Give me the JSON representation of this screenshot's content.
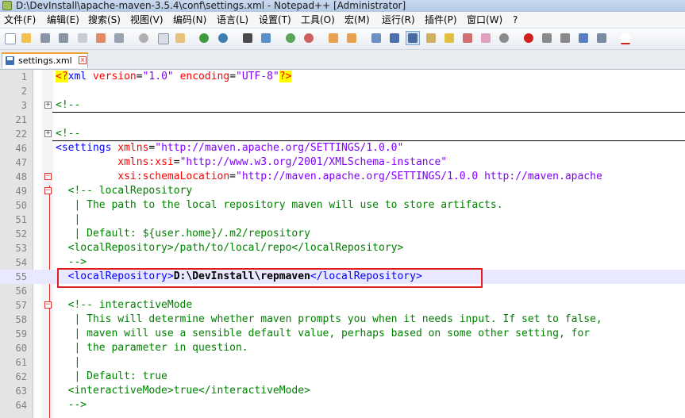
{
  "window": {
    "title": "D:\\DevInstall\\apache-maven-3.5.4\\conf\\settings.xml - Notepad++ [Administrator]"
  },
  "menu": [
    "文件(F)",
    "编辑(E)",
    "搜索(S)",
    "视图(V)",
    "编码(N)",
    "语言(L)",
    "设置(T)",
    "工具(O)",
    "宏(M)",
    "运行(R)",
    "插件(P)",
    "窗口(W)",
    "?"
  ],
  "tab": {
    "label": "settings.xml",
    "close": "x"
  },
  "lines": [
    {
      "num": "1",
      "code": "<?xml version=\"1.0\" encoding=\"UTF-8\"?>"
    },
    {
      "num": "2",
      "code": ""
    },
    {
      "num": "3",
      "code": "<!--"
    },
    {
      "num": "21",
      "code": ""
    },
    {
      "num": "22",
      "code": "<!--"
    },
    {
      "num": "46",
      "code": "<settings xmlns=\"http://maven.apache.org/SETTINGS/1.0.0\""
    },
    {
      "num": "47",
      "code": "          xmlns:xsi=\"http://www.w3.org/2001/XMLSchema-instance\""
    },
    {
      "num": "48",
      "code": "          xsi:schemaLocation=\"http://maven.apache.org/SETTINGS/1.0.0 http://maven.apache"
    },
    {
      "num": "49",
      "code": "  <!-- localRepository"
    },
    {
      "num": "50",
      "code": "   | The path to the local repository maven will use to store artifacts."
    },
    {
      "num": "51",
      "code": "   |"
    },
    {
      "num": "52",
      "code": "   | Default: ${user.home}/.m2/repository"
    },
    {
      "num": "53",
      "code": "  <localRepository>/path/to/local/repo</localRepository>"
    },
    {
      "num": "54",
      "code": "  -->"
    },
    {
      "num": "55",
      "code": "  <localRepository>D:\\DevInstall\\repmaven</localRepository>"
    },
    {
      "num": "56",
      "code": ""
    },
    {
      "num": "57",
      "code": "  <!-- interactiveMode"
    },
    {
      "num": "58",
      "code": "   | This will determine whether maven prompts you when it needs input. If set to false,"
    },
    {
      "num": "59",
      "code": "   | maven will use a sensible default value, perhaps based on some other setting, for"
    },
    {
      "num": "60",
      "code": "   | the parameter in question."
    },
    {
      "num": "61",
      "code": "   |"
    },
    {
      "num": "62",
      "code": "   | Default: true"
    },
    {
      "num": "63",
      "code": "  <interactiveMode>true</interactiveMode>"
    },
    {
      "num": "64",
      "code": "  -->"
    }
  ],
  "colors": {
    "tag": "#0000ff",
    "attribute": "#ff0000",
    "value": "#8000ff",
    "comment": "#008000",
    "highlight_box": "#e02020"
  }
}
